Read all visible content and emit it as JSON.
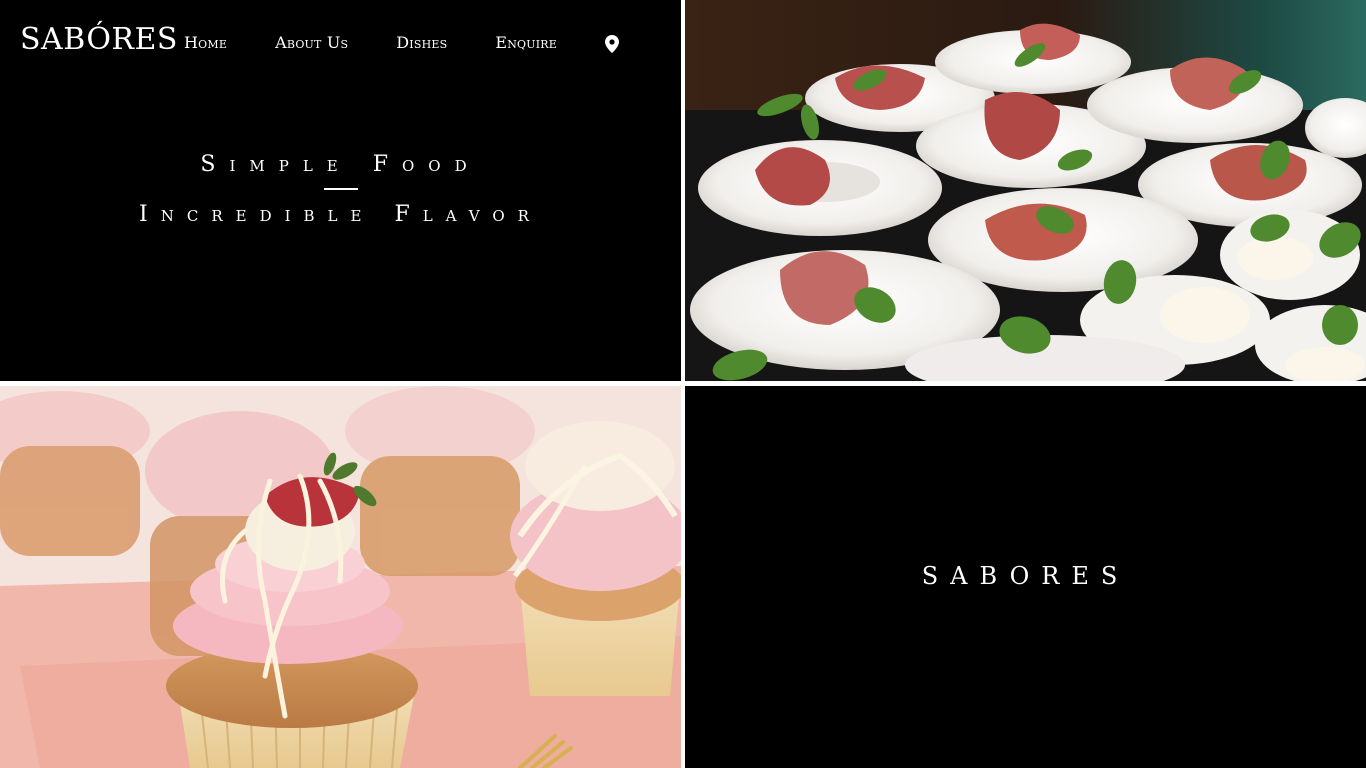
{
  "brand": {
    "logo": "SABÓRES"
  },
  "nav": {
    "items": [
      "Home",
      "About Us",
      "Dishes",
      "Enquire"
    ],
    "location_icon": "map-pin-icon"
  },
  "hero": {
    "line1": "Simple Food",
    "line2": "Incredible Flavor"
  },
  "tiles": {
    "top_right_image": "plated-prosciutto-appetizers-photo",
    "bottom_left_image": "strawberry-cupcakes-photo",
    "bottom_right_text": "SABORES"
  },
  "colors": {
    "background": "#000000",
    "text": "#ffffff",
    "divider": "#ffffff"
  }
}
